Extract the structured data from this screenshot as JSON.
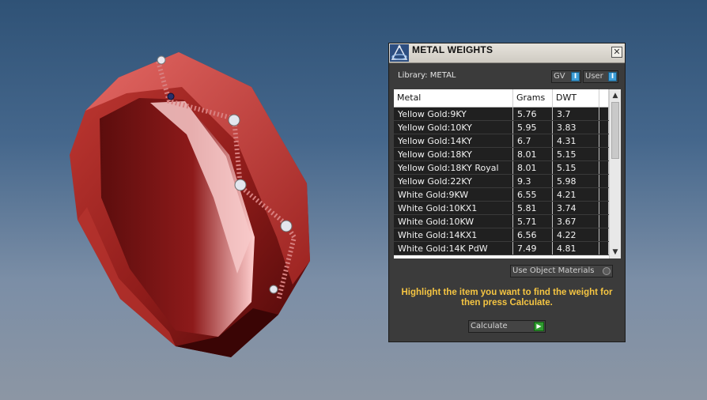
{
  "panel": {
    "title": "METAL WEIGHTS",
    "close_symbol": "✕",
    "library_label": "Library: METAL",
    "gv_label": "GV",
    "user_label": "User",
    "toggle_indicator": "I",
    "columns": [
      "Metal",
      "Grams",
      "DWT"
    ],
    "rows": [
      {
        "metal": "Yellow Gold:9KY",
        "grams": "5.76",
        "dwt": "3.7"
      },
      {
        "metal": "Yellow Gold:10KY",
        "grams": "5.95",
        "dwt": "3.83"
      },
      {
        "metal": "Yellow Gold:14KY",
        "grams": "6.7",
        "dwt": "4.31"
      },
      {
        "metal": "Yellow Gold:18KY",
        "grams": "8.01",
        "dwt": "5.15"
      },
      {
        "metal": "Yellow Gold:18KY Royal",
        "grams": "8.01",
        "dwt": "5.15"
      },
      {
        "metal": "Yellow Gold:22KY",
        "grams": "9.3",
        "dwt": "5.98"
      },
      {
        "metal": "White Gold:9KW",
        "grams": "6.55",
        "dwt": "4.21"
      },
      {
        "metal": "White Gold:10KX1",
        "grams": "5.81",
        "dwt": "3.74"
      },
      {
        "metal": "White Gold:10KW",
        "grams": "5.71",
        "dwt": "3.67"
      },
      {
        "metal": "White Gold:14KX1",
        "grams": "6.56",
        "dwt": "4.22"
      },
      {
        "metal": "White Gold:14K PdW",
        "grams": "7.49",
        "dwt": "4.81"
      }
    ],
    "use_object_label": "Use Object Materials",
    "instructions": "Highlight the item you want to find the weight for then press Calculate.",
    "calculate_label": "Calculate"
  },
  "colors": {
    "ring": "#9c1f1f",
    "instruction_text": "#f5c542",
    "toggle_indicator": "#3e9ed8",
    "calculate_go": "#2f9a2f"
  },
  "icons": [
    "app-logo-icon",
    "close-icon",
    "scroll-up-icon",
    "scroll-down-icon",
    "play-arrow-icon",
    "radio-icon"
  ]
}
